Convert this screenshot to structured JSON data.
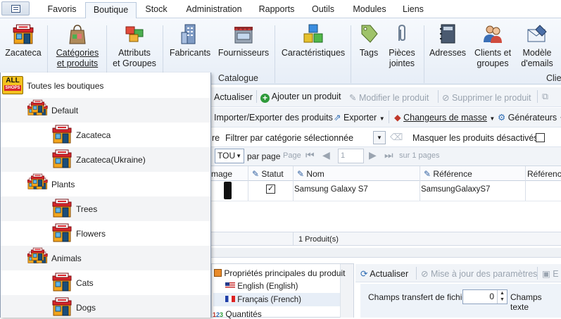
{
  "tabs": [
    "Favoris",
    "Boutique",
    "Stock",
    "Administration",
    "Rapports",
    "Outils",
    "Modules",
    "Liens"
  ],
  "ribbon": {
    "buttons": [
      {
        "label1": "Zacateca",
        "label2": ""
      },
      {
        "label1": "Catégories",
        "label2": "et produits"
      },
      {
        "label1": "Attributs",
        "label2": "et Groupes"
      },
      {
        "label1": "Fabricants",
        "label2": ""
      },
      {
        "label1": "Fournisseurs",
        "label2": ""
      },
      {
        "label1": "Caractéristiques",
        "label2": ""
      },
      {
        "label1": "Tags",
        "label2": ""
      },
      {
        "label1": "Pièces",
        "label2": "jointes"
      },
      {
        "label1": "Adresses",
        "label2": ""
      },
      {
        "label1": "Clients et",
        "label2": "groupes"
      },
      {
        "label1": "Modèle",
        "label2": "d'emails"
      }
    ],
    "group_catalogue": "Catalogue",
    "group_clients": "Clie"
  },
  "toolbar1": {
    "refresh": "Actualiser",
    "add": "Ajouter un produit",
    "edit": "Modifier le produit",
    "delete": "Supprimer le produit"
  },
  "toolbar2": {
    "importexport": "Importer/Exporter des produits",
    "export": "Exporter",
    "mass": "Changeurs de masse",
    "generators": "Générateurs"
  },
  "filterbar": {
    "prefix": "re",
    "label": "Filtrer par catégorie sélectionnée",
    "hide_disabled": "Masquer les produits désactivés"
  },
  "pager": {
    "perpage_value": "TOU",
    "perpage_label": "par page",
    "page_label": "Page",
    "page_value": "1",
    "total": "sur 1 pages"
  },
  "grid": {
    "headers": [
      "mage",
      "Statut",
      "Nom",
      "Référence",
      "Référence"
    ],
    "rows": [
      {
        "name": "Samsung Galaxy S7",
        "reference": "SamsungGalaxyS7"
      }
    ],
    "footer": "1 Produit(s)"
  },
  "properties": {
    "title": "Propriétés principales du produit",
    "lang_en": "English (English)",
    "lang_fr": "Français (French)",
    "quantities": "Quantités"
  },
  "bottom_toolbar": {
    "refresh": "Actualiser",
    "update_params": "Mise à jour des paramètres",
    "more": "E"
  },
  "transfer": {
    "label": "Champs transfert de fichier",
    "value": "0",
    "label2": "Champs texte"
  },
  "shops": {
    "all_badge_top": "ALL",
    "all_badge_bottom": "SHOPS",
    "all_label": "Toutes les boutiques",
    "items": [
      {
        "label": "Default"
      },
      {
        "label": "Zacateca"
      },
      {
        "label": "Zacateca(Ukraine)"
      },
      {
        "label": "Plants"
      },
      {
        "label": "Trees"
      },
      {
        "label": "Flowers"
      },
      {
        "label": "Animals"
      },
      {
        "label": "Cats"
      },
      {
        "label": "Dogs"
      }
    ]
  }
}
